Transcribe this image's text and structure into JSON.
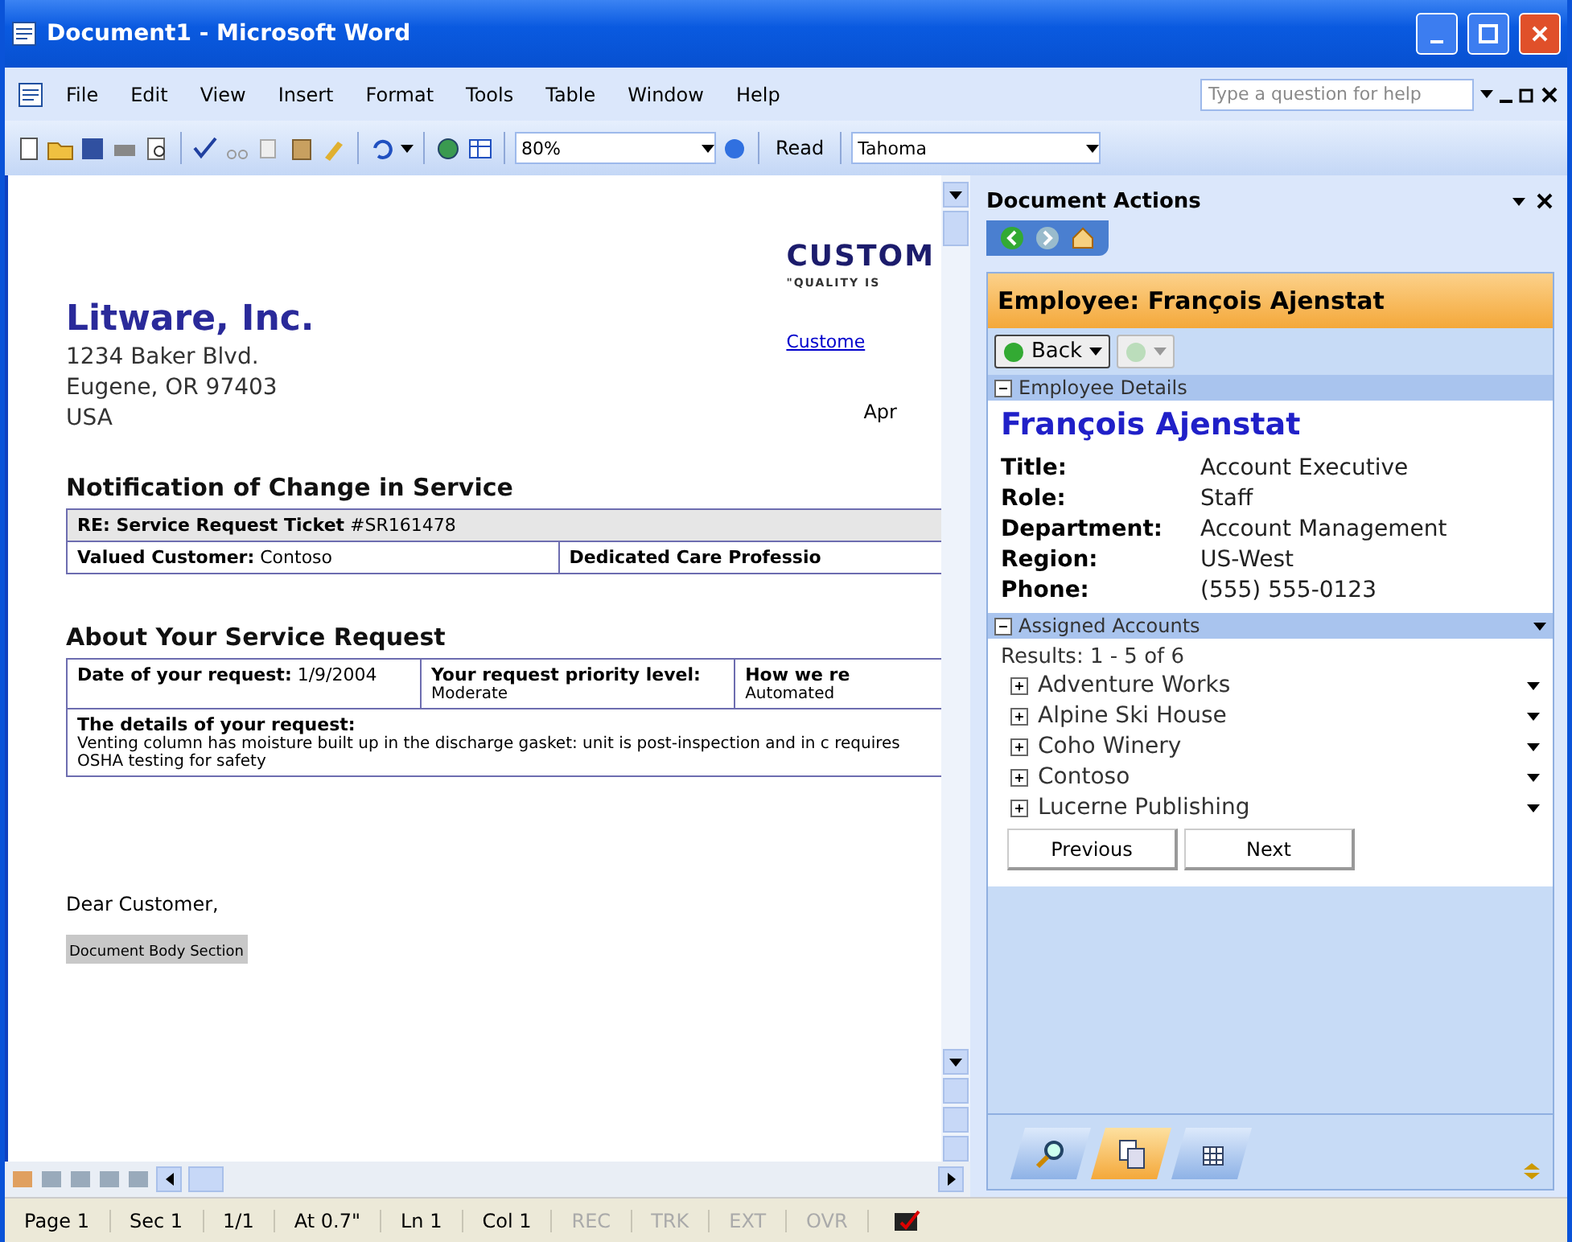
{
  "window": {
    "title": "Document1 - Microsoft Word"
  },
  "menu": [
    "File",
    "Edit",
    "View",
    "Insert",
    "Format",
    "Tools",
    "Table",
    "Window",
    "Help"
  ],
  "help_field": {
    "placeholder": "Type a question for help"
  },
  "toolbar": {
    "zoom": "80%",
    "read_button": "Read",
    "font": "Tahoma"
  },
  "document": {
    "company": {
      "name": "Litware, Inc.",
      "address": [
        "1234 Baker Blvd.",
        "Eugene, OR 97403",
        "USA"
      ]
    },
    "banner": {
      "title": "CUSTOM",
      "tagline": "\"QUALITY IS",
      "link": "Custome",
      "date": "Apr"
    },
    "notice_title": "Notification of Change in Service",
    "ticket": {
      "label": "RE: Service Request Ticket",
      "value": "#SR161478"
    },
    "customer": {
      "label": "Valued Customer:",
      "value": "Contoso"
    },
    "professional": {
      "label": "Dedicated Care Professio"
    },
    "request_title": "About Your Service Request",
    "request": [
      {
        "label": "Date of your request:",
        "value": "1/9/2004"
      },
      {
        "label": "Your request priority level:",
        "value": "Moderate"
      },
      {
        "label": "How we re",
        "value": "Automated"
      }
    ],
    "details": {
      "label": "The details of your request:",
      "text": "Venting column has moisture built up in the discharge gasket: unit is post-inspection and in c requires OSHA testing for safety"
    },
    "greeting": "Dear Customer,",
    "section_marker": "Document Body Section"
  },
  "task_pane": {
    "title": "Document Actions",
    "header": "Employee: François Ajenstat",
    "back_button": "Back",
    "sections": [
      {
        "title": "Employee Details",
        "expanded": true,
        "name": "François Ajenstat",
        "fields": [
          {
            "label": "Title:",
            "value": "Account Executive"
          },
          {
            "label": "Role:",
            "value": "Staff"
          },
          {
            "label": "Department:",
            "value": "Account Management"
          },
          {
            "label": "Region:",
            "value": "US-West"
          },
          {
            "label": "Phone:",
            "value": "(555) 555-0123"
          }
        ]
      },
      {
        "title": "Assigned Accounts",
        "expanded": true,
        "results": "Results: 1 - 5 of 6",
        "accounts": [
          {
            "name": "Adventure Works",
            "expanded": false
          },
          {
            "name": "Alpine Ski House",
            "expanded": false
          },
          {
            "name": "Coho Winery",
            "expanded": false
          },
          {
            "name": "Contoso",
            "expanded": false
          },
          {
            "name": "Lucerne Publishing",
            "expanded": false
          }
        ],
        "buttons": [
          "Previous",
          "Next"
        ]
      }
    ],
    "tabs": [
      {
        "kind": "search",
        "selected": false
      },
      {
        "kind": "documents",
        "selected": true
      },
      {
        "kind": "table",
        "selected": false
      }
    ]
  },
  "status_bar": [
    {
      "text": "Page 1",
      "disabled": false
    },
    {
      "text": "Sec 1",
      "disabled": false
    },
    {
      "text": "1/1",
      "disabled": false
    },
    {
      "text": "At 0.7\"",
      "disabled": false
    },
    {
      "text": "Ln 1",
      "disabled": false
    },
    {
      "text": "Col 1",
      "disabled": false
    },
    {
      "text": "REC",
      "disabled": true
    },
    {
      "text": "TRK",
      "disabled": true
    },
    {
      "text": "EXT",
      "disabled": true
    },
    {
      "text": "OVR",
      "disabled": true
    }
  ]
}
